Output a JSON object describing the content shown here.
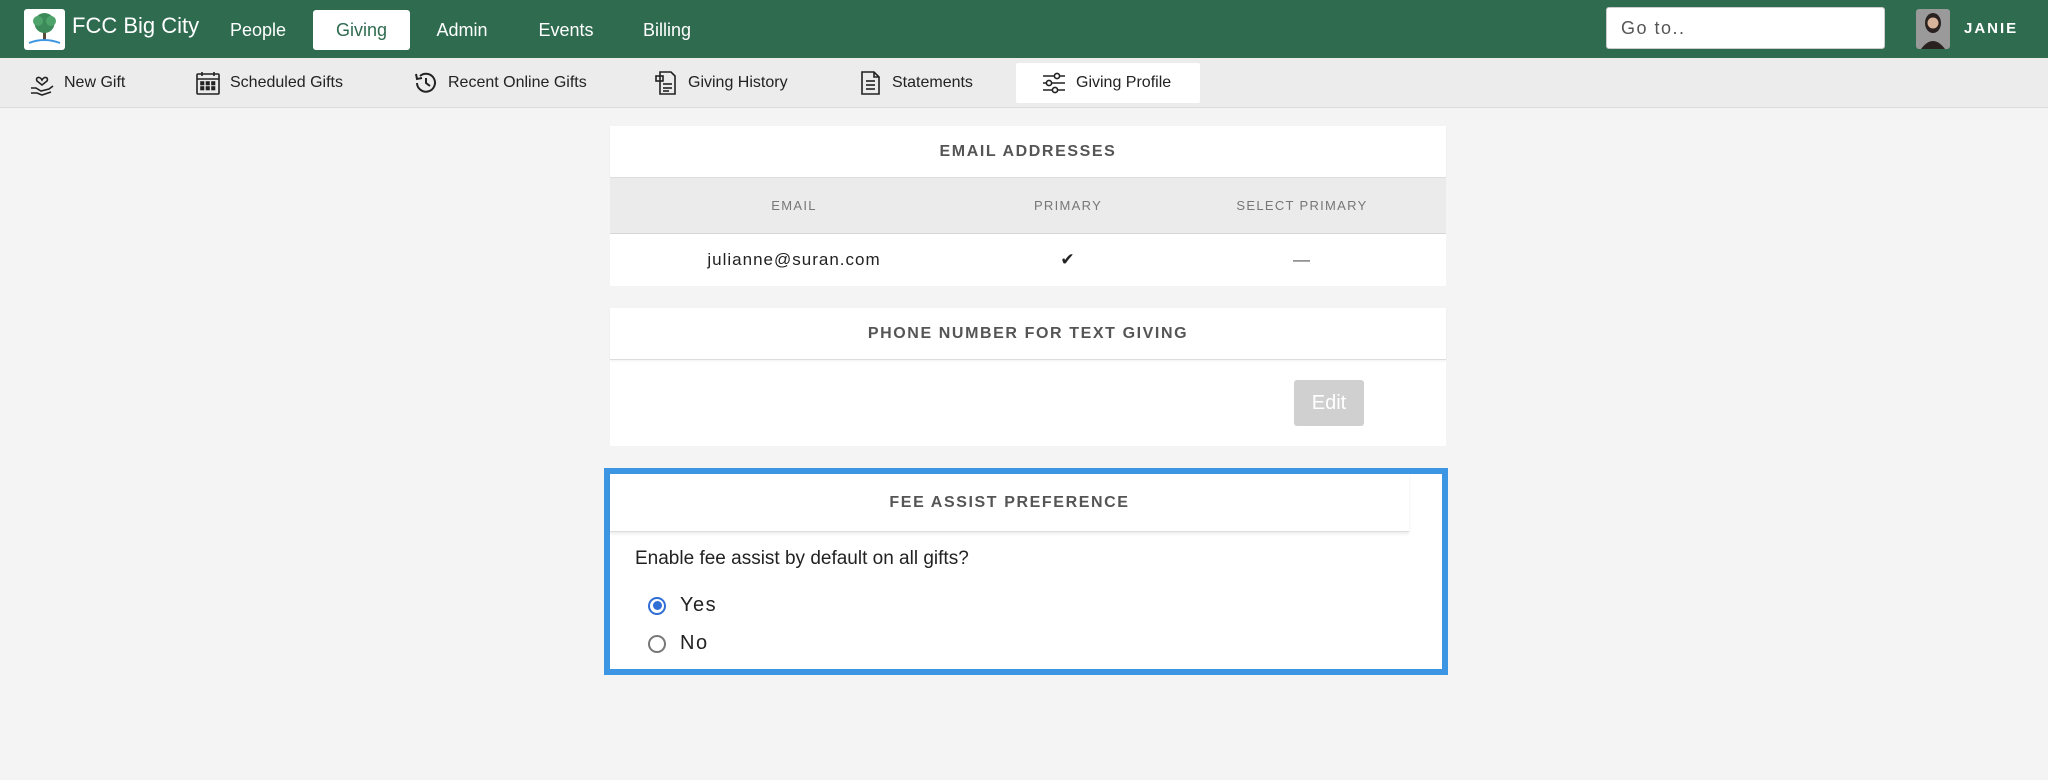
{
  "app": {
    "name": "FCC Big City"
  },
  "nav": {
    "items": [
      {
        "label": "People"
      },
      {
        "label": "Giving",
        "active": true
      },
      {
        "label": "Admin"
      },
      {
        "label": "Events"
      },
      {
        "label": "Billing"
      }
    ],
    "search_placeholder": "Go to..",
    "user_name": "JANIE"
  },
  "subnav": {
    "items": [
      {
        "label": "New Gift",
        "icon": "hand-heart-icon"
      },
      {
        "label": "Scheduled Gifts",
        "icon": "calendar-icon"
      },
      {
        "label": "Recent Online Gifts",
        "icon": "history-icon"
      },
      {
        "label": "Giving History",
        "icon": "document-list-icon"
      },
      {
        "label": "Statements",
        "icon": "document-icon"
      },
      {
        "label": "Giving Profile",
        "icon": "sliders-icon",
        "active": true
      }
    ]
  },
  "email_section": {
    "title": "EMAIL ADDRESSES",
    "columns": [
      "EMAIL",
      "PRIMARY",
      "SELECT PRIMARY"
    ],
    "rows": [
      {
        "email": "julianne@suran.com",
        "primary": "✔",
        "select_primary": "—"
      }
    ]
  },
  "phone_section": {
    "title": "PHONE NUMBER FOR TEXT GIVING",
    "edit_label": "Edit"
  },
  "fee_section": {
    "title": "FEE ASSIST PREFERENCE",
    "question": "Enable fee assist by default on all gifts?",
    "options": [
      {
        "label": "Yes",
        "selected": true
      },
      {
        "label": "No",
        "selected": false
      }
    ]
  },
  "colors": {
    "brand_green": "#2e6b4f",
    "highlight_blue": "#3d96e3",
    "radio_blue": "#2f6fd6"
  }
}
